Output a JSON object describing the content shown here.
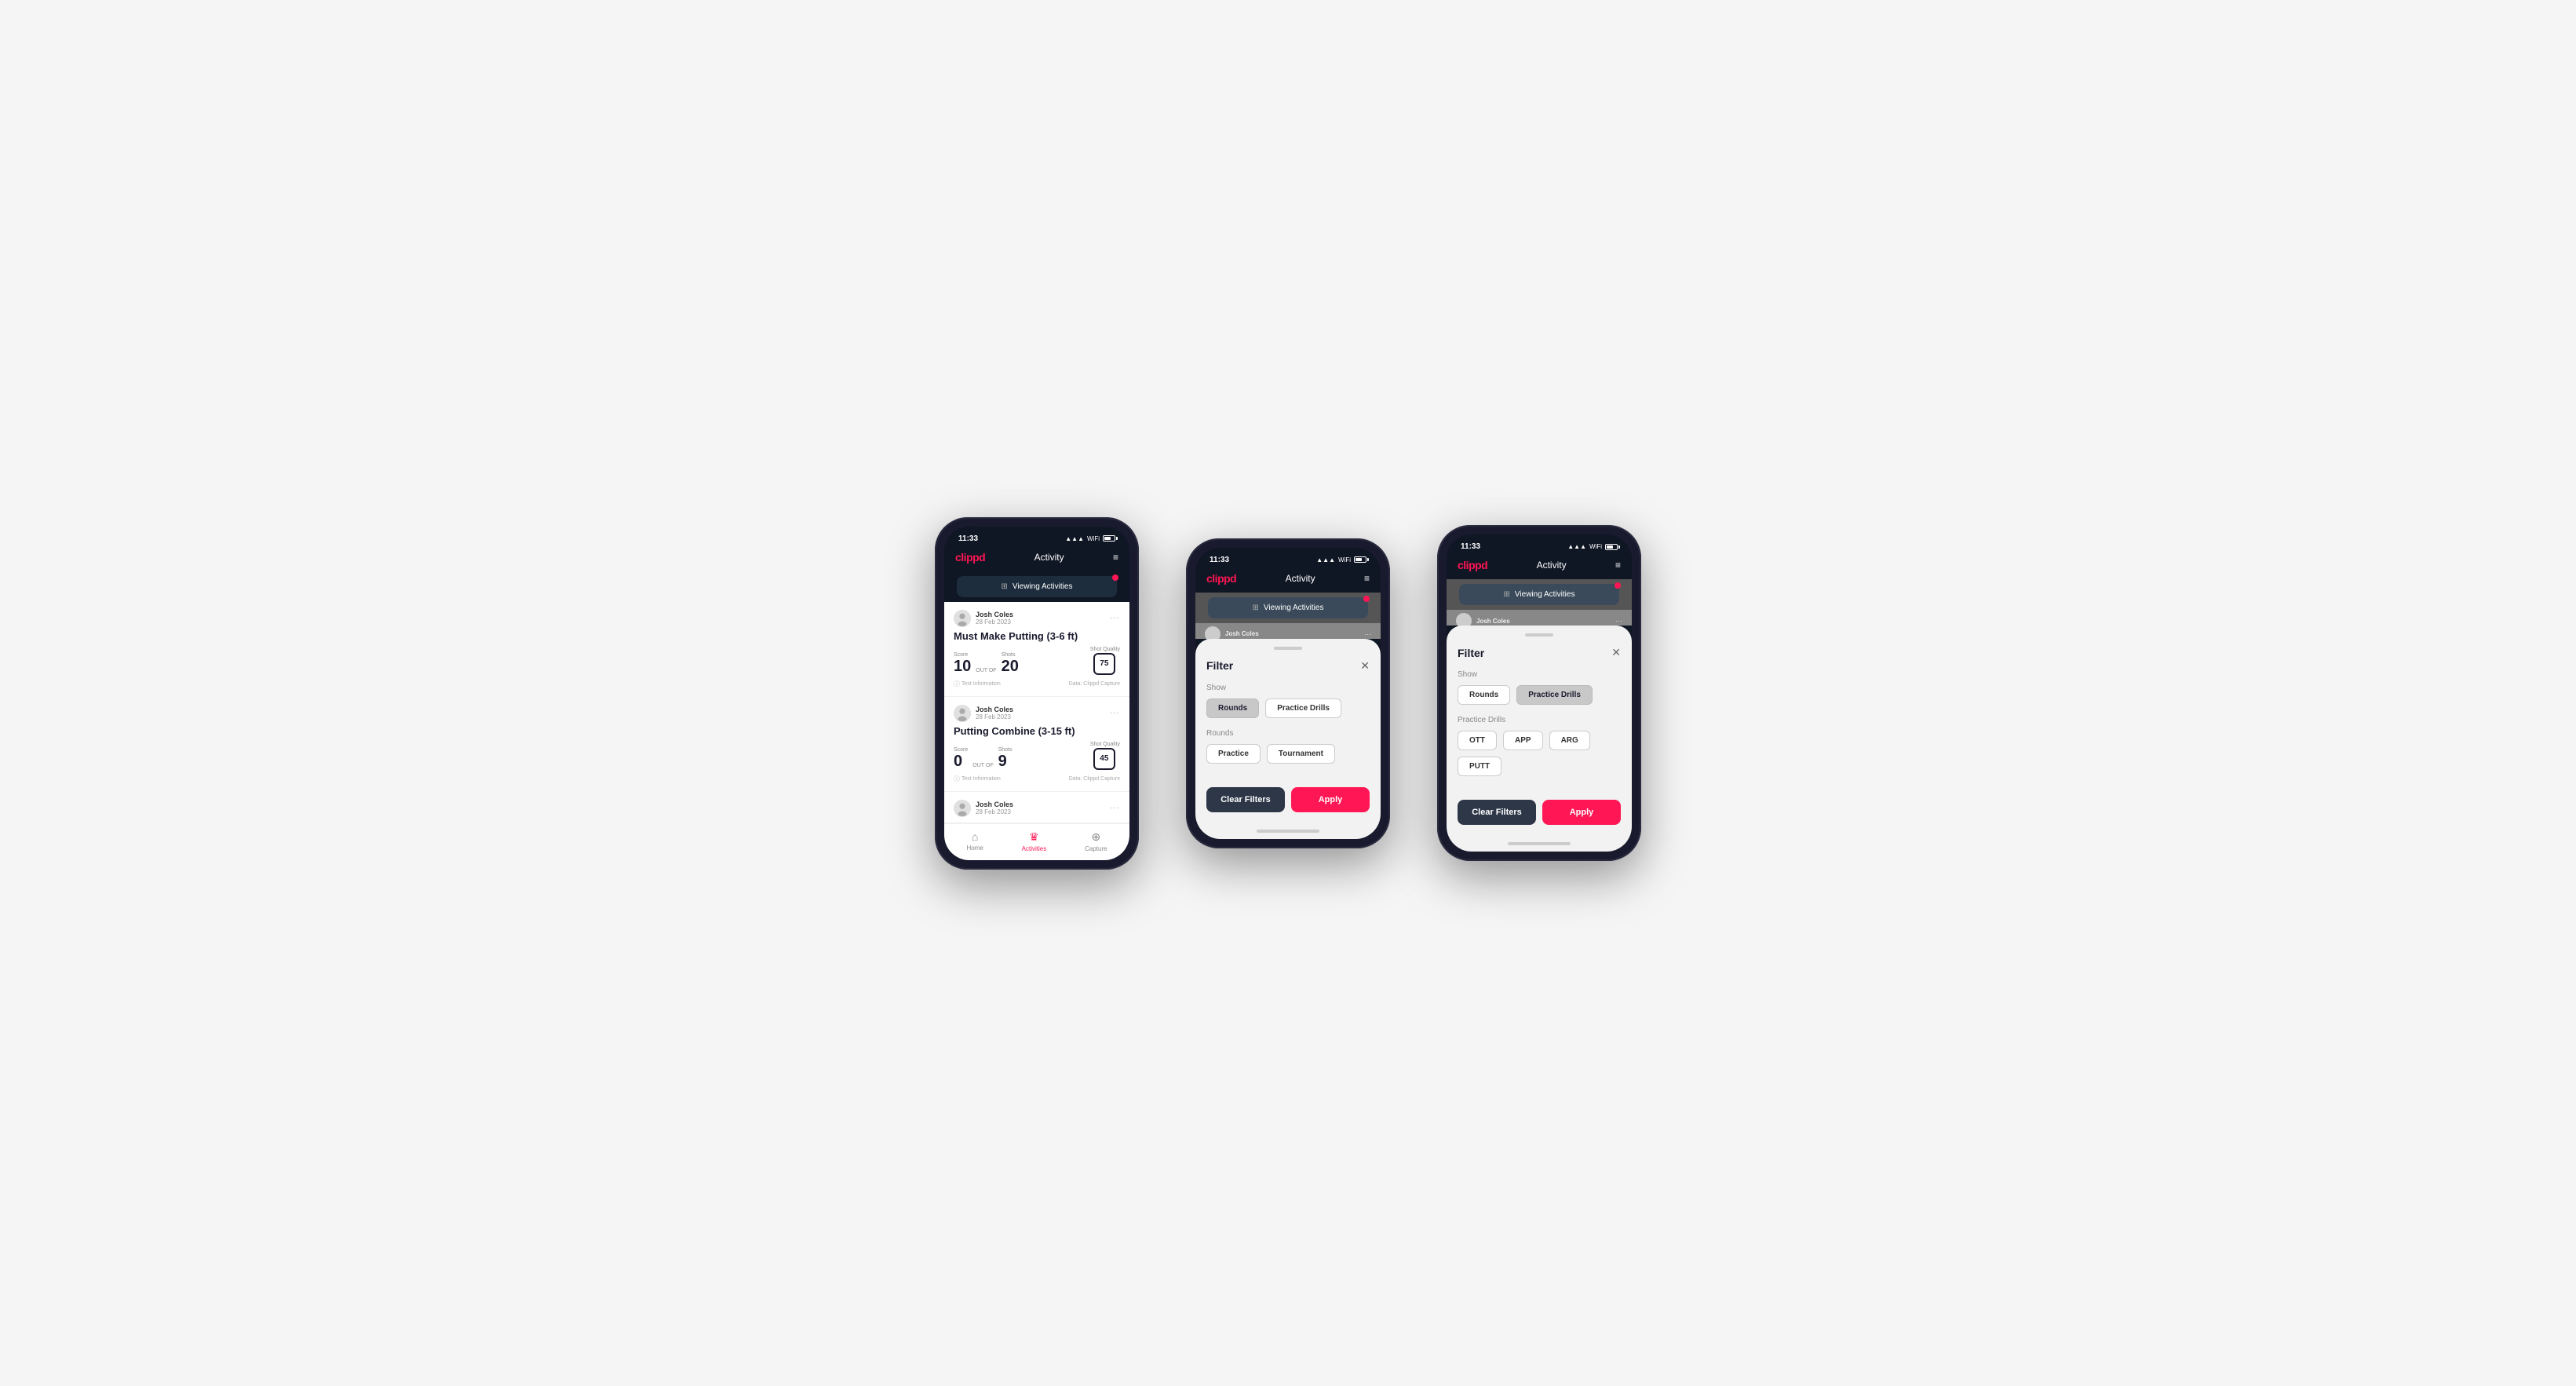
{
  "phones": [
    {
      "id": "phone1",
      "type": "activity-list",
      "status_bar": {
        "time": "11:33",
        "battery": "51"
      },
      "header": {
        "logo": "clippd",
        "title": "Activity",
        "menu_icon": "≡"
      },
      "viewing_bar": {
        "label": "Viewing Activities",
        "filter_icon": "⊞"
      },
      "activities": [
        {
          "user": "Josh Coles",
          "date": "28 Feb 2023",
          "title": "Must Make Putting (3-6 ft)",
          "score_label": "Score",
          "score": "10",
          "out_of_label": "OUT OF",
          "shots_label": "Shots",
          "shots": "20",
          "quality_label": "Shot Quality",
          "quality": "75",
          "test_info": "Test Information",
          "data_source": "Data: Clippd Capture"
        },
        {
          "user": "Josh Coles",
          "date": "28 Feb 2023",
          "title": "Putting Combine (3-15 ft)",
          "score_label": "Score",
          "score": "0",
          "out_of_label": "OUT OF",
          "shots_label": "Shots",
          "shots": "9",
          "quality_label": "Shot Quality",
          "quality": "45",
          "test_info": "Test Information",
          "data_source": "Data: Clippd Capture"
        },
        {
          "user": "Josh Coles",
          "date": "28 Feb 2023",
          "title": "",
          "score_label": "",
          "score": "",
          "out_of_label": "",
          "shots_label": "",
          "shots": "",
          "quality_label": "",
          "quality": "",
          "test_info": "",
          "data_source": ""
        }
      ],
      "bottom_nav": [
        {
          "icon": "🏠",
          "label": "Home",
          "active": false
        },
        {
          "icon": "♛",
          "label": "Activities",
          "active": true
        },
        {
          "icon": "⊕",
          "label": "Capture",
          "active": false
        }
      ]
    },
    {
      "id": "phone2",
      "type": "filter-rounds",
      "status_bar": {
        "time": "11:33",
        "battery": "51"
      },
      "header": {
        "logo": "clippd",
        "title": "Activity",
        "menu_icon": "≡"
      },
      "viewing_bar": {
        "label": "Viewing Activities"
      },
      "filter": {
        "title": "Filter",
        "close_icon": "✕",
        "show_label": "Show",
        "show_buttons": [
          {
            "label": "Rounds",
            "active": true
          },
          {
            "label": "Practice Drills",
            "active": false
          }
        ],
        "rounds_label": "Rounds",
        "rounds_buttons": [
          {
            "label": "Practice",
            "active": false
          },
          {
            "label": "Tournament",
            "active": false
          }
        ],
        "clear_label": "Clear Filters",
        "apply_label": "Apply"
      }
    },
    {
      "id": "phone3",
      "type": "filter-drills",
      "status_bar": {
        "time": "11:33",
        "battery": "51"
      },
      "header": {
        "logo": "clippd",
        "title": "Activity",
        "menu_icon": "≡"
      },
      "viewing_bar": {
        "label": "Viewing Activities"
      },
      "filter": {
        "title": "Filter",
        "close_icon": "✕",
        "show_label": "Show",
        "show_buttons": [
          {
            "label": "Rounds",
            "active": false
          },
          {
            "label": "Practice Drills",
            "active": true
          }
        ],
        "drills_label": "Practice Drills",
        "drills_buttons": [
          {
            "label": "OTT",
            "active": false
          },
          {
            "label": "APP",
            "active": false
          },
          {
            "label": "ARG",
            "active": false
          },
          {
            "label": "PUTT",
            "active": false
          }
        ],
        "clear_label": "Clear Filters",
        "apply_label": "Apply"
      }
    }
  ]
}
